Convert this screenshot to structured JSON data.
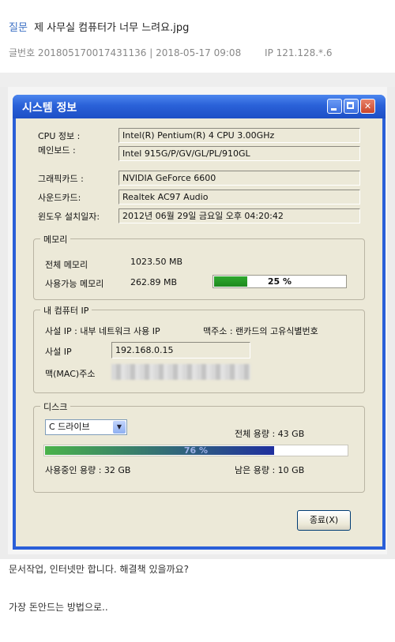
{
  "post": {
    "category": "질문",
    "title": "제 사무실 컴퓨터가 너무 느려요.jpg",
    "post_number_label": "글번호 201805170017431136",
    "date": "2018-05-17 09:08",
    "ip": "IP 121.128.*.6",
    "body_line1": "문서작업, 인터넷만 합니다. 해결책 있을까요?",
    "body_line2": "가장 돈안드는 방법으로.."
  },
  "window": {
    "title": "시스템 정보",
    "close_glyph": "✕"
  },
  "system": {
    "cpu_label": "CPU 정보 :",
    "cpu_value": "Intel(R) Pentium(R) 4 CPU 3.00GHz",
    "board_label": "메인보드 :",
    "board_value": "Intel  915G/P/GV/GL/PL/910GL",
    "gpu_label": "그래픽카드 :",
    "gpu_value": "NVIDIA GeForce 6600",
    "sound_label": "사운드카드:",
    "sound_value": "Realtek AC97 Audio",
    "install_label": "윈도우 설치일자:",
    "install_value": "2012년 06월 29일 금요일 오후 04:20:42"
  },
  "memory": {
    "group_title": "메모리",
    "total_label": "전체 메모리",
    "total_value": "1023.50 MB",
    "avail_label": "사용가능 메모리",
    "avail_value": "262.89 MB",
    "usage_percent": 25,
    "usage_text": "25 %",
    "bar_color": "#2fa82f"
  },
  "network": {
    "group_title": "내 컴퓨터 IP",
    "desc_left": "사설 IP : 내부 네트워크 사용 IP",
    "desc_right": "맥주소 : 랜카드의 고유식별번호",
    "private_ip_label": "사설 IP",
    "private_ip_value": "192.168.0.15",
    "mac_label": "맥(MAC)주소"
  },
  "disk": {
    "group_title": "디스크",
    "drive_selected": "C 드라이브",
    "total_label": "전체 용량 : 43 GB",
    "usage_percent": 76,
    "usage_text": "76 %",
    "used_label": "사용중인 용량 : 32 GB",
    "free_label": "남은 용량 : 10 GB",
    "bar_color_start": "#4ab24a",
    "bar_color_end": "#1f2f9e"
  },
  "buttons": {
    "close_label": "종료(X)"
  }
}
